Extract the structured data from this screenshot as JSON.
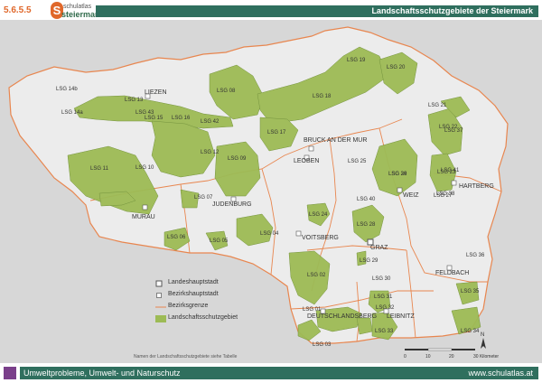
{
  "header": {
    "code": "5.6.5.5",
    "logo_s": "S",
    "logo_top": "schulatlas",
    "logo_main": "steiermark",
    "title": "Landschaftsschutzgebiete der Steiermark"
  },
  "map": {
    "places": [
      {
        "id": "liezen",
        "label": "LIEZEN"
      },
      {
        "id": "bruck",
        "label": "BRUCK AN DER MUR"
      },
      {
        "id": "leoben",
        "label": "LEOBEN"
      },
      {
        "id": "judenburg",
        "label": "JUDENBURG"
      },
      {
        "id": "murau",
        "label": "MURAU"
      },
      {
        "id": "weiz",
        "label": "WEIZ"
      },
      {
        "id": "hartberg",
        "label": "HARTBERG"
      },
      {
        "id": "voitsberg",
        "label": "VOITSBERG"
      },
      {
        "id": "graz",
        "label": "GRAZ"
      },
      {
        "id": "feldbach",
        "label": "FELDBACH"
      },
      {
        "id": "deutschlandsberg",
        "label": "DEUTSCHLANDSBERG"
      },
      {
        "id": "leibnitz",
        "label": "LEIBNITZ"
      }
    ],
    "areas": [
      "LSG 14b",
      "LSG 14a",
      "LSG 13",
      "LSG 43",
      "LSG 15",
      "LSG 16",
      "LSG 01",
      "LSG 02",
      "LSG 03",
      "LSG 04",
      "LSG 05",
      "LSG 06",
      "LSG 07",
      "LSG 08",
      "LSG 09",
      "LSG 10",
      "LSG 11",
      "LSG 12",
      "LSG 17",
      "LSG 18",
      "LSG 19",
      "LSG 20",
      "LSG 21",
      "LSG 22",
      "LSG 23",
      "LSG 24",
      "LSG 25",
      "LSG 26",
      "LSG 27",
      "LSG 28",
      "LSG 29",
      "LSG 30",
      "LSG 31",
      "LSG 32",
      "LSG 33",
      "LSG 34",
      "LSG 35",
      "LSG 36",
      "LSG 37",
      "LSG 38",
      "LSG 39",
      "LSG 40",
      "LSG 41",
      "LSG 42",
      "LSG 44",
      "LSG 45"
    ],
    "colors": {
      "protected_area": "#9dbb55",
      "district_border": "#e8864f",
      "state_border": "#e8864f",
      "background": "#d7d7d7",
      "state_fill": "#e9e9e9"
    }
  },
  "legend": {
    "capital": "Landeshauptstadt",
    "district_capital": "Bezirkshauptstadt",
    "district_border": "Bezirksgrenze",
    "protected_area": "Landschaftsschutzgebiet",
    "note": "Namen der Landschaftsschutzgebiete siehe Tabelle"
  },
  "scalebar": {
    "ticks": [
      "0",
      "10",
      "20",
      "30 Kilometer"
    ],
    "north": "N"
  },
  "footer": {
    "left": "Umweltprobleme, Umwelt- und Naturschutz",
    "right": "www.schulatlas.at"
  }
}
